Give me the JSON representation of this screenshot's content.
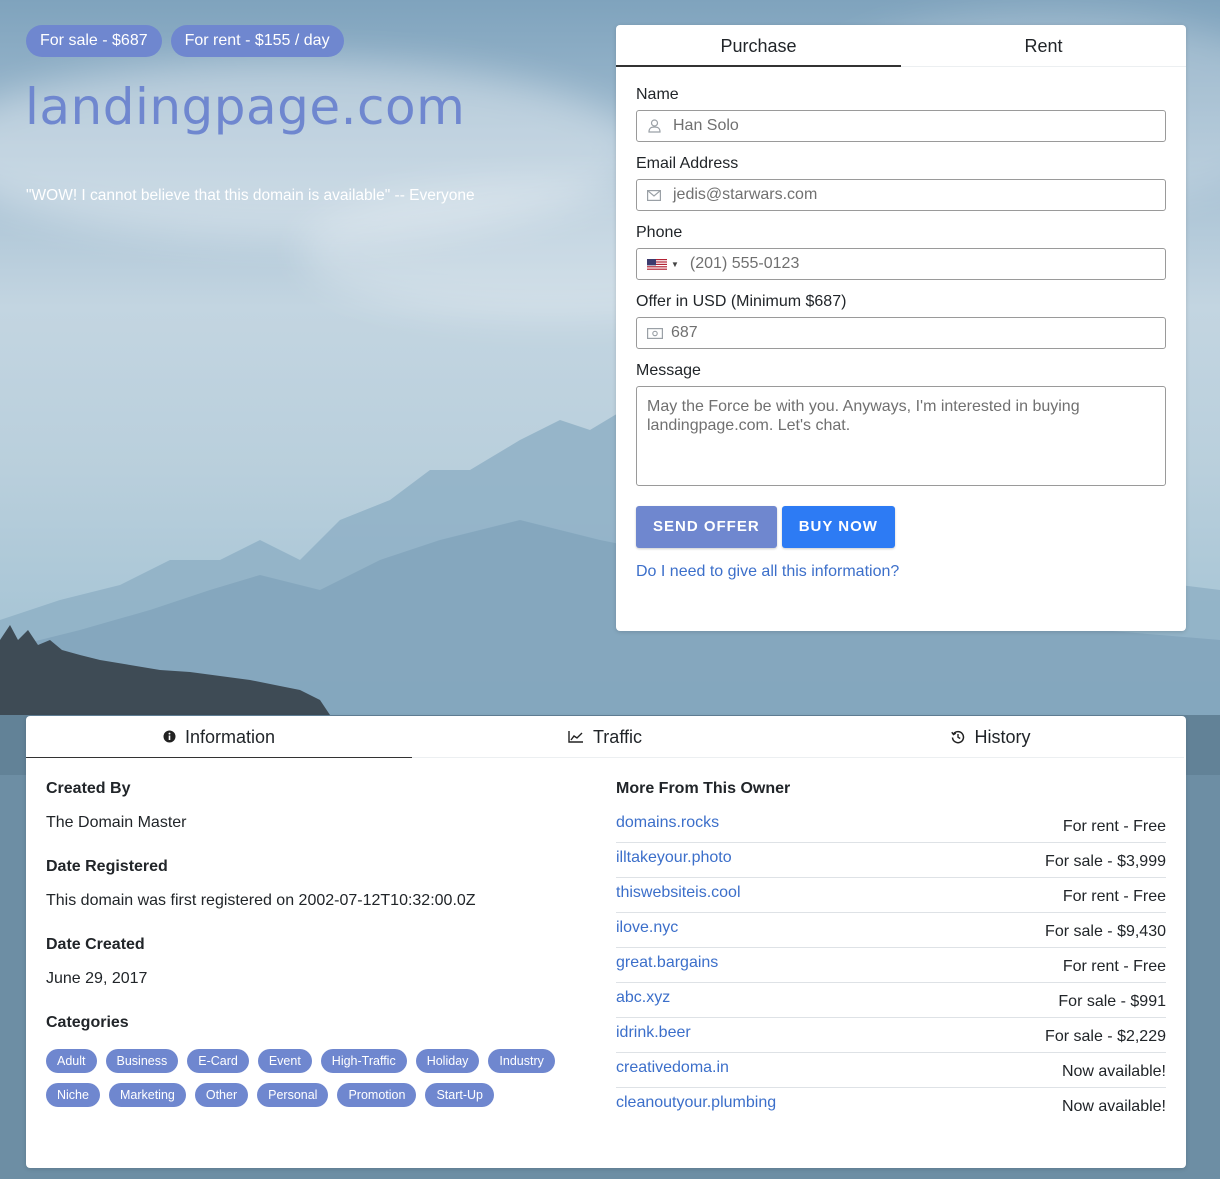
{
  "badges": {
    "sale": "For sale - $687",
    "rent": "For rent - $155 / day"
  },
  "domain": "landingpage.com",
  "tagline": "\"WOW! I cannot believe that this domain is available\" -- Everyone",
  "form": {
    "tabs": [
      "Purchase",
      "Rent"
    ],
    "active_tab": "Purchase",
    "name_label": "Name",
    "name_placeholder": "Han Solo",
    "email_label": "Email Address",
    "email_placeholder": "jedis@starwars.com",
    "phone_label": "Phone",
    "phone_placeholder": "(201) 555-0123",
    "offer_label": "Offer in USD (Minimum $687)",
    "offer_placeholder": "687",
    "message_label": "Message",
    "message_placeholder": "May the Force be with you. Anyways, I'm interested in buying landingpage.com. Let's chat.",
    "send_button": "SEND OFFER",
    "buy_button": "BUY NOW",
    "help_link": "Do I need to give all this information?",
    "icons": {
      "name": "user-icon",
      "email": "envelope-icon",
      "phone": "us-flag-icon",
      "offer": "money-icon"
    }
  },
  "info": {
    "tabs": [
      {
        "label": "Information",
        "icon": "info-circle-icon"
      },
      {
        "label": "Traffic",
        "icon": "line-chart-icon"
      },
      {
        "label": "History",
        "icon": "history-icon"
      }
    ],
    "active_tab": "Information",
    "created_by_label": "Created By",
    "created_by": "The Domain Master",
    "date_registered_label": "Date Registered",
    "date_registered": "This domain was first registered on 2002-07-12T10:32:00.0Z",
    "date_created_label": "Date Created",
    "date_created": "June 29, 2017",
    "categories_label": "Categories",
    "categories": [
      "Adult",
      "Business",
      "E-Card",
      "Event",
      "High-Traffic",
      "Holiday",
      "Industry",
      "Niche",
      "Marketing",
      "Other",
      "Personal",
      "Promotion",
      "Start-Up"
    ],
    "more_label": "More From This Owner",
    "owner_domains": [
      {
        "name": "domains.rocks",
        "status": "For rent - Free"
      },
      {
        "name": "illtakeyour.photo",
        "status": "For sale - $3,999"
      },
      {
        "name": "thiswebsiteis.cool",
        "status": "For rent - Free"
      },
      {
        "name": "ilove.nyc",
        "status": "For sale - $9,430"
      },
      {
        "name": "great.bargains",
        "status": "For rent - Free"
      },
      {
        "name": "abc.xyz",
        "status": "For sale - $991"
      },
      {
        "name": "idrink.beer",
        "status": "For sale - $2,229"
      },
      {
        "name": "creativedoma.in",
        "status": "Now available!"
      },
      {
        "name": "cleanoutyour.plumbing",
        "status": "Now available!"
      }
    ]
  },
  "colors": {
    "accent": "#6f87cf",
    "primary": "#2d7bf4",
    "link": "#3c6fca"
  }
}
